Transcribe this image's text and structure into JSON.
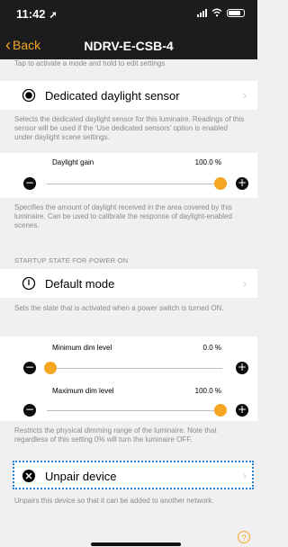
{
  "status_bar": {
    "time": "11:42"
  },
  "nav": {
    "back_label": "Back",
    "title": "NDRV-E-CSB-4"
  },
  "top_cutoff_text": "Tap to activate a mode and hold to edit settings",
  "daylight_sensor": {
    "label": "Dedicated daylight sensor",
    "description": "Selects the dedicated daylight sensor for this luminaire. Readings of this sensor will be used if the 'Use dedicated sensors' option is enabled under daylight scene settings."
  },
  "daylight_gain": {
    "label": "Daylight gain",
    "value_text": "100.0 %",
    "level": 1.0,
    "description": "Specifies the amount of daylight received in the area covered by this luminaire. Can be used to calibrate the response of daylight-enabled scenes."
  },
  "startup": {
    "section_header": "STARTUP STATE FOR POWER ON",
    "label": "Default mode",
    "description": "Sets the state that is activated when a power switch is turned ON."
  },
  "min_dim": {
    "label": "Minimum dim level",
    "value_text": "0.0 %",
    "level": 0.0
  },
  "max_dim": {
    "label": "Maximum dim level",
    "value_text": "100.0 %",
    "level": 1.0
  },
  "dim_description": "Restricts the physical dimming range of the luminaire. Note that regardless of this setting 0% will turn the luminaire OFF.",
  "unpair": {
    "label": "Unpair device",
    "description": "Unpairs this device so that it can be added to another network."
  },
  "colors": {
    "accent": "#f5a623",
    "focus": "#2a7fd6"
  },
  "icons": {
    "chevron": "›",
    "minus": "−",
    "plus": "+",
    "help": "?"
  }
}
